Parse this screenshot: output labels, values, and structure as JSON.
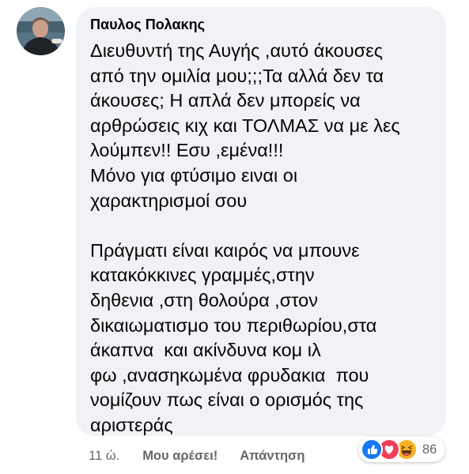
{
  "comment": {
    "author": "Παυλος Πολακης",
    "lines": [
      "Διευθυντή της Αυγής ,αυτό άκουσες",
      "από την ομιλία μου;;;Τα αλλά δεν τα",
      "άκουσες; Η απλά δεν μπορείς να",
      "αρθρώσεις κιχ και ΤΟΛΜΑΣ να με λες",
      "λούμπεν!! Εσυ ,εμένα!!!",
      "Μόνο για φτύσιμο ειναι οι",
      "χαρακτηρισμοί σου",
      "",
      "Πράγματι είναι καιρός να μπουνε",
      "κατακόκκινες γραμμές,στην",
      "δηθενια ,στη θολούρα ,στον",
      "δικαιωματισμο του περιθωρίου,στα",
      "άκαπνα  και ακίνδυνα κομ ιλ",
      "φω ,ανασηκωμένα φρυδακια  που",
      "νομίζουν πως είναι ο ορισμός της",
      "αριστεράς"
    ]
  },
  "actions": {
    "time": "11 ώ.",
    "like_label": "Μου αρέσει!",
    "reply_label": "Απάντηση"
  },
  "reactions": {
    "icons": [
      "like-icon",
      "love-icon",
      "haha-icon"
    ],
    "count": "86"
  },
  "colors": {
    "bubble": "#f0f2f5",
    "meta_text": "#65676b",
    "like_blue": "#1877f2",
    "love_red": "#f33e58",
    "haha_yellow": "#f7b125"
  }
}
